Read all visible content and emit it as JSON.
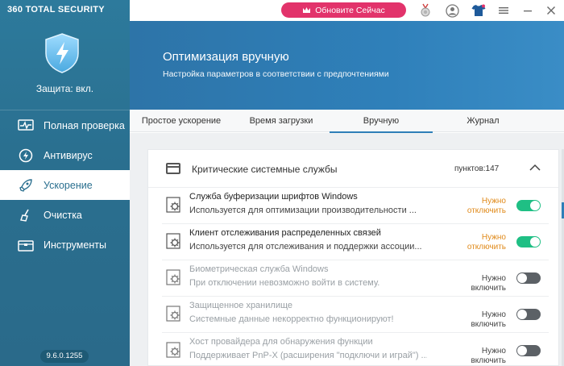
{
  "app": {
    "brand": "360 TOTAL SECURITY",
    "protection_status": "Защита: вкл.",
    "version": "9.6.0.1255"
  },
  "sidebar": {
    "items": [
      {
        "label": "Полная проверка",
        "icon": "pulse-monitor-icon",
        "active": false
      },
      {
        "label": "Антивирус",
        "icon": "antivirus-icon",
        "active": false
      },
      {
        "label": "Ускорение",
        "icon": "rocket-icon",
        "active": true
      },
      {
        "label": "Очистка",
        "icon": "broom-icon",
        "active": false
      },
      {
        "label": "Инструменты",
        "icon": "toolbox-icon",
        "active": false
      }
    ]
  },
  "topbar": {
    "upgrade_label": "Обновите Сейчас",
    "icons": [
      "medal-icon",
      "user-icon",
      "tshirt-icon",
      "menu-icon",
      "minimize-icon",
      "close-icon"
    ]
  },
  "banner": {
    "title": "Оптимизация вручную",
    "subtitle": "Настройка параметров в соответствии с предпочтениями"
  },
  "tabs": [
    {
      "label": "Простое ускорение",
      "active": false
    },
    {
      "label": "Время загрузки",
      "active": false
    },
    {
      "label": "Вручную",
      "active": true
    },
    {
      "label": "Журнал",
      "active": false
    }
  ],
  "section": {
    "title": "Критические системные службы",
    "count_label": "пунктов:147"
  },
  "services": [
    {
      "title": "Служба буферизации шрифтов Windows",
      "description": "Используется для оптимизации производительности ...",
      "status": "Нужно отключить",
      "enabled": true
    },
    {
      "title": "Клиент отслеживания распределенных связей",
      "description": "Используется для отслеживания и поддержки ассоции...",
      "status": "Нужно отключить",
      "enabled": true
    },
    {
      "title": "Биометрическая служба Windows",
      "description": "При отключении невозможно войти в систему.",
      "status": "Нужно включить",
      "enabled": false
    },
    {
      "title": "Защищенное хранилище",
      "description": "Системные данные некорректно функционируют!",
      "status": "Нужно включить",
      "enabled": false
    },
    {
      "title": "Хост провайдера для обнаружения функции",
      "description": "Поддерживает PnP-X (расширения \"подключи и играй\") ...",
      "status": "Нужно включить",
      "enabled": false
    }
  ],
  "colors": {
    "sidebar": "#2a6f8f",
    "banner": "#2f80ba",
    "upgrade": "#e2336b",
    "toggle_on": "#1fbf84",
    "toggle_off": "#5c6166",
    "warn": "#e08a1a"
  }
}
